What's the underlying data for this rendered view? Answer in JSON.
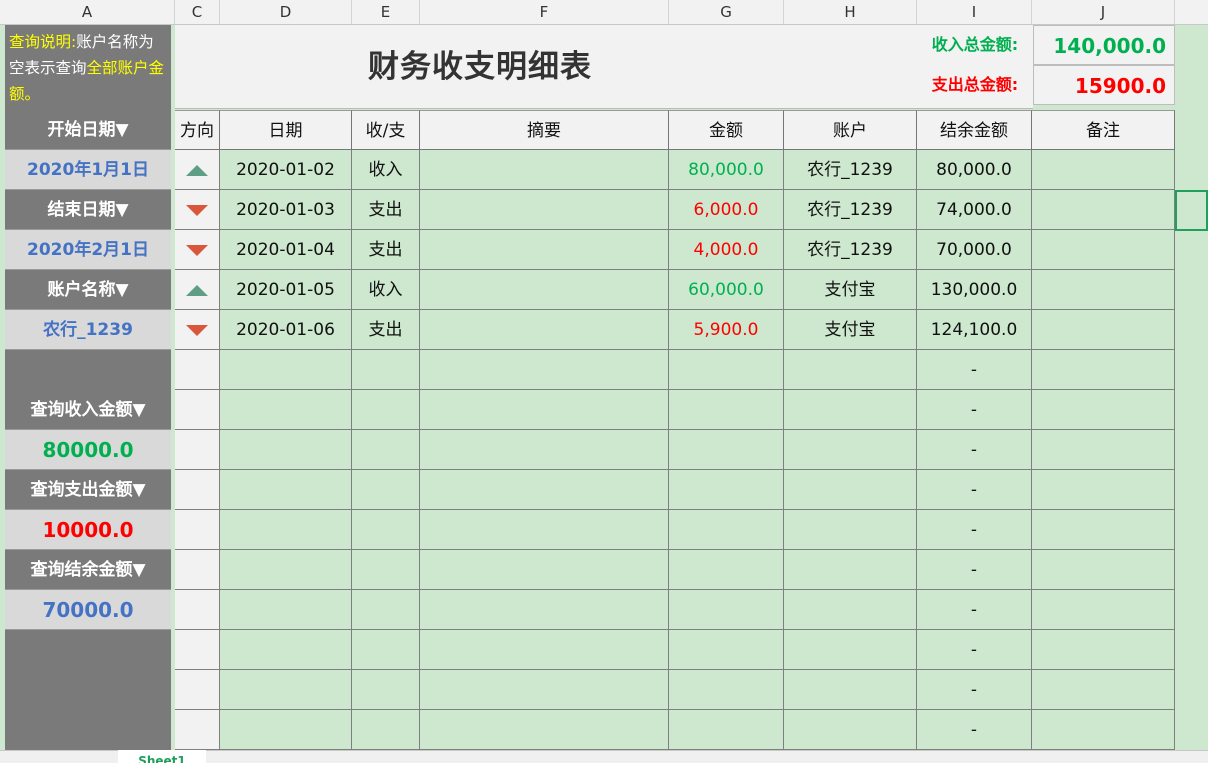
{
  "columns": [
    "A",
    "C",
    "D",
    "E",
    "F",
    "G",
    "H",
    "I",
    "J"
  ],
  "note": {
    "p1": "查询说明:",
    "p2": "账户名称为空表示查询",
    "p3": "全部账户金额。"
  },
  "filters": [
    {
      "label": "开始日期▼",
      "value": "2020年1月1日",
      "color": "blue"
    },
    {
      "label": "结束日期▼",
      "value": "2020年2月1日",
      "color": "blue"
    },
    {
      "label": "账户名称▼",
      "value": "农行_1239",
      "color": "blue"
    }
  ],
  "queries": [
    {
      "label": "查询收入金额▼",
      "value": "80000.0",
      "color": "green"
    },
    {
      "label": "查询支出金额▼",
      "value": "10000.0",
      "color": "red"
    },
    {
      "label": "查询结余金额▼",
      "value": "70000.0",
      "color": "blue"
    }
  ],
  "title": "财务收支明细表",
  "summary": {
    "income_label": "收入总金额:",
    "income_value": "140,000.0",
    "expense_label": "支出总金额:",
    "expense_value": "15900.0"
  },
  "headers": [
    "方向",
    "日期",
    "收/支",
    "摘要",
    "金额",
    "账户",
    "结余金额",
    "备注"
  ],
  "rows": [
    {
      "dir": "up",
      "date": "2020-01-02",
      "type": "收入",
      "summary": "",
      "amount": "80,000.0",
      "account": "农行_1239",
      "balance": "80,000.0",
      "note": ""
    },
    {
      "dir": "down",
      "date": "2020-01-03",
      "type": "支出",
      "summary": "",
      "amount": "6,000.0",
      "account": "农行_1239",
      "balance": "74,000.0",
      "note": ""
    },
    {
      "dir": "down",
      "date": "2020-01-04",
      "type": "支出",
      "summary": "",
      "amount": "4,000.0",
      "account": "农行_1239",
      "balance": "70,000.0",
      "note": ""
    },
    {
      "dir": "up",
      "date": "2020-01-05",
      "type": "收入",
      "summary": "",
      "amount": "60,000.0",
      "account": "支付宝",
      "balance": "130,000.0",
      "note": ""
    },
    {
      "dir": "down",
      "date": "2020-01-06",
      "type": "支出",
      "summary": "",
      "amount": "5,900.0",
      "account": "支付宝",
      "balance": "124,100.0",
      "note": ""
    }
  ],
  "empty_balance": "-",
  "empty_rows": 10,
  "sheet_tab": "Sheet1",
  "colors": {
    "income": "#00b050",
    "expense": "#ff0000",
    "up": "#5f9e85",
    "down": "#d9573b"
  }
}
